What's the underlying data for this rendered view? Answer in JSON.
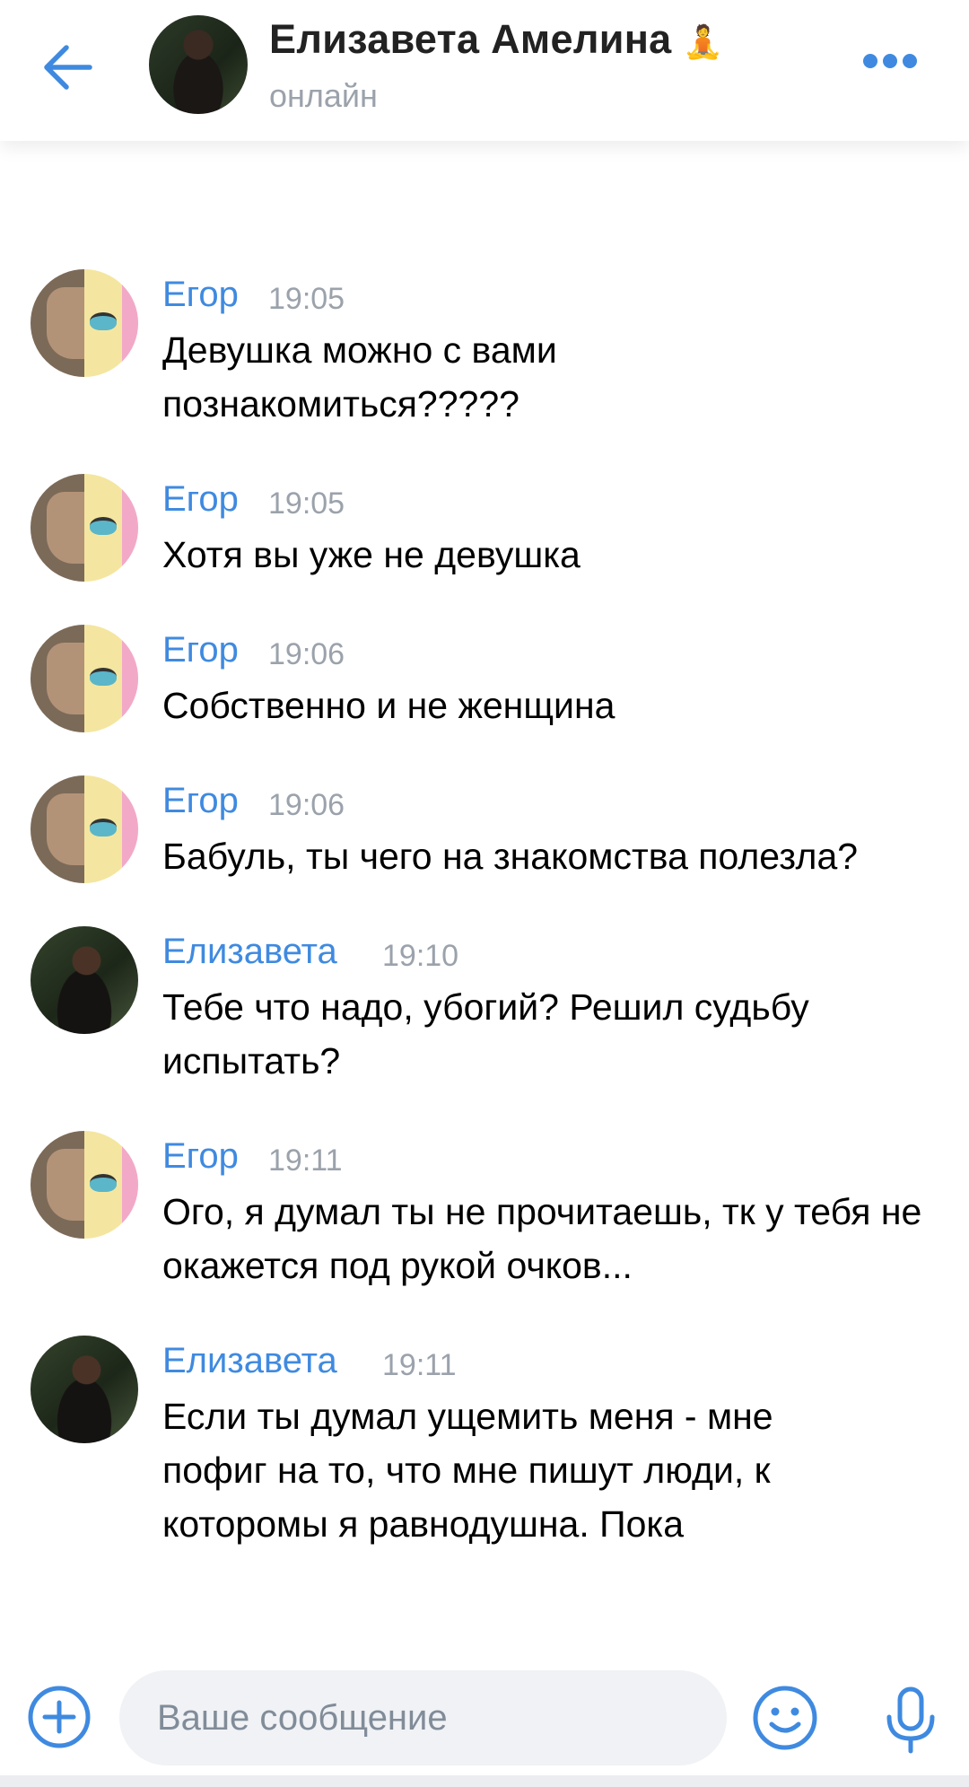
{
  "header": {
    "title": "Елизавета Амелина",
    "title_emoji": "🧘",
    "status": "онлайн",
    "back_icon": "arrow-left-icon",
    "more_icon": "more-horizontal-icon"
  },
  "messages": [
    {
      "sender": "Егор",
      "time": "19:05",
      "text": "Девушка можно с вами познакомиться?????"
    },
    {
      "sender": "Егор",
      "time": "19:05",
      "text": "Хотя вы уже не девушка"
    },
    {
      "sender": "Егор",
      "time": "19:06",
      "text": "Собственно и не женщина"
    },
    {
      "sender": "Егор",
      "time": "19:06",
      "text": "Бабуль, ты чего на знакомства полезла?"
    },
    {
      "sender": "Елизавета",
      "time": "19:10",
      "text": "Тебе что надо, убогий? Решил судьбу испытать?"
    },
    {
      "sender": "Егор",
      "time": "19:11",
      "text": "Ого, я думал ты не прочитаешь, тк у тебя не окажется под рукой очков..."
    },
    {
      "sender": "Елизавета",
      "time": "19:11",
      "text": "Если ты думал ущемить меня - мне пофиг на то, что мне пишут люди, к которомы я равнодушна. Пока"
    }
  ],
  "composer": {
    "placeholder": "Ваше сообщение",
    "value": "",
    "add_icon": "add-circle-icon",
    "emoji_icon": "smile-icon",
    "mic_icon": "microphone-icon"
  },
  "colors": {
    "accent": "#3f8ae0",
    "secondary_text": "#9ba2ab",
    "input_bg": "#f0f2f5"
  }
}
